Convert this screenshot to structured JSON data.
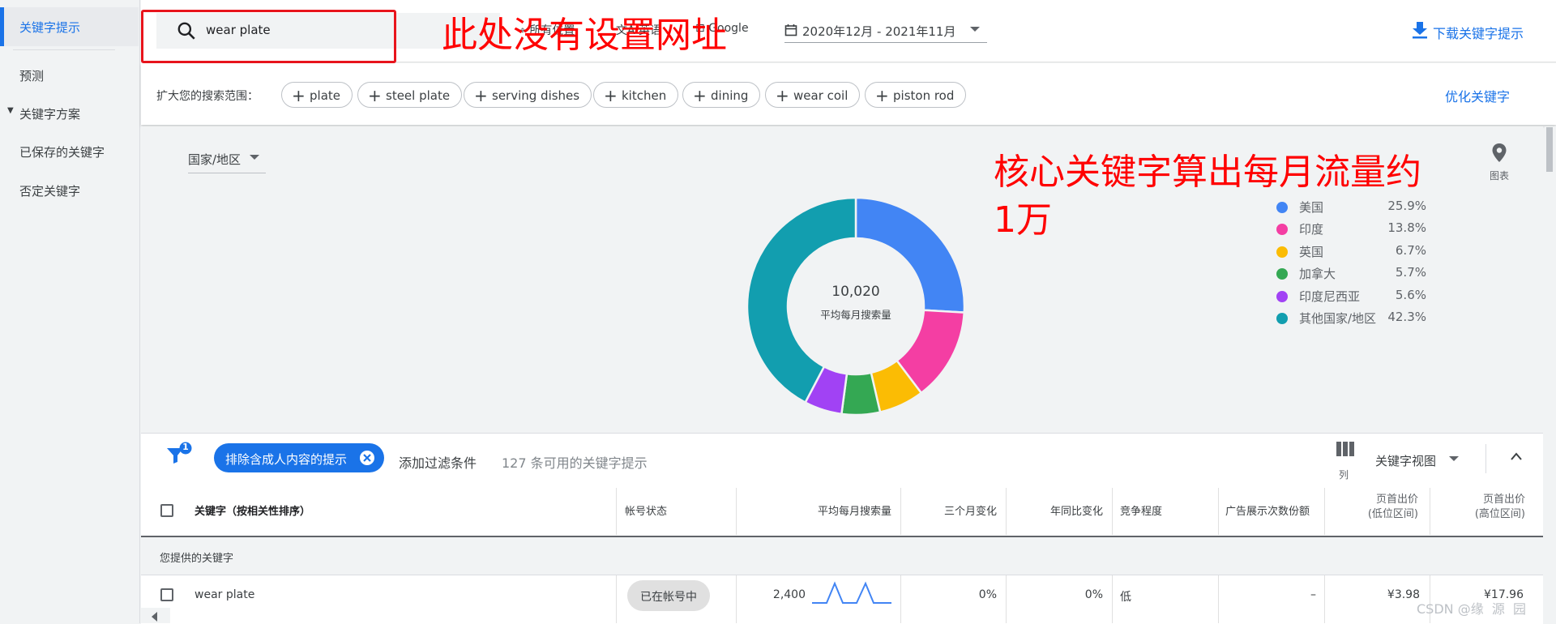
{
  "sidebar": {
    "items": [
      {
        "label": "关键字提示"
      },
      {
        "label": "预测"
      },
      {
        "label": "关键字方案"
      },
      {
        "label": "已保存的关键字"
      },
      {
        "label": "否定关键字"
      }
    ],
    "caret": "▼"
  },
  "topbar": {
    "search_value": "wear plate",
    "filters_partial": [
      "所有位置",
      "英语",
      "Google"
    ],
    "date_range": "2020年12月 - 2021年11月",
    "download_label": "下载关键字提示"
  },
  "annotations": {
    "note1": "此处没有设置网址",
    "note2_line1": "核心关键字算出每月流量约",
    "note2_line2": "1万",
    "color": "#ff0000"
  },
  "expand": {
    "label": "扩大您的搜索范围：",
    "chips": [
      "plate",
      "steel plate",
      "serving dishes",
      "kitchen",
      "dining",
      "wear coil",
      "piston rod"
    ],
    "refine_label": "优化关键字"
  },
  "chart_controls": {
    "region_label": "国家/地区",
    "chart_icon_label": "图表"
  },
  "chart_data": {
    "type": "pie",
    "center_value": "10,020",
    "center_label": "平均每月搜索量",
    "slices": [
      {
        "label": "美国",
        "value": 25.9,
        "display": "25.9%",
        "color": "#4285f4"
      },
      {
        "label": "印度",
        "value": 13.8,
        "display": "13.8%",
        "color": "#f43ea3"
      },
      {
        "label": "英国",
        "value": 6.7,
        "display": "6.7%",
        "color": "#fbbc04"
      },
      {
        "label": "加拿大",
        "value": 5.7,
        "display": "5.7%",
        "color": "#34a853"
      },
      {
        "label": "印度尼西亚",
        "value": 5.6,
        "display": "5.6%",
        "color": "#a142f4"
      },
      {
        "label": "其他国家/地区",
        "value": 42.3,
        "display": "42.3%",
        "color": "#129eaf"
      }
    ]
  },
  "filterbar": {
    "filter_count": "1",
    "exclude_chip": "排除含成人内容的提示",
    "add_filter": "添加过滤条件",
    "available": "127 条可用的关键字提示",
    "columns_label": "列",
    "view_label": "关键字视图"
  },
  "table": {
    "headers": {
      "keyword": "关键字（按相关性排序）",
      "status": "帐号状态",
      "avg": "平均每月搜索量",
      "three_month": "三个月变化",
      "yoy": "年同比变化",
      "competition": "竞争程度",
      "impression_share": "广告展示次数份额",
      "bid_low_1": "页首出价",
      "bid_low_2": "(低位区间)",
      "bid_high_1": "页首出价",
      "bid_high_2": "(高位区间)"
    },
    "section_label": "您提供的关键字",
    "rows": [
      {
        "keyword": "wear plate",
        "status": "已在帐号中",
        "avg": "2,400",
        "three_month": "0%",
        "yoy": "0%",
        "competition": "低",
        "impression_share": "–",
        "bid_low": "¥3.98",
        "bid_high": "¥17.96"
      }
    ]
  },
  "watermark": "CSDN @缘  源  园"
}
